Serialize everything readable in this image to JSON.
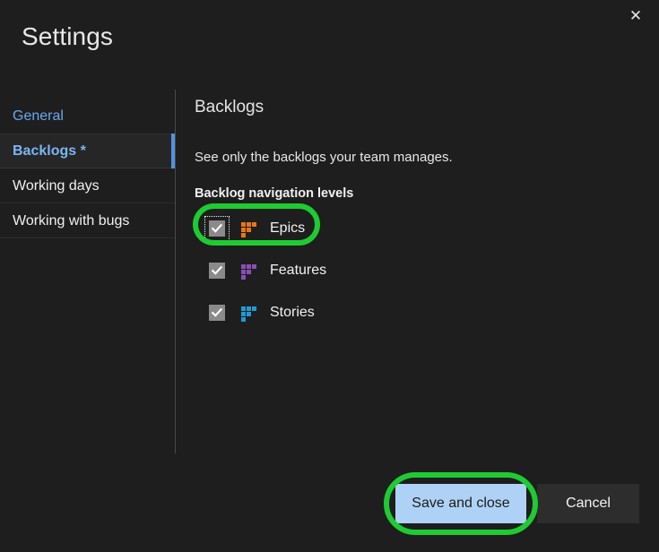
{
  "dialog": {
    "title": "Settings",
    "close_icon": "close-icon",
    "close_glyph": "✕"
  },
  "sidebar": {
    "items": [
      {
        "label": "General",
        "state": "link",
        "selected": false
      },
      {
        "label": "Backlogs *",
        "state": "selected",
        "selected": true
      },
      {
        "label": "Working days",
        "state": "normal",
        "selected": false
      },
      {
        "label": "Working with bugs",
        "state": "normal",
        "selected": false
      }
    ]
  },
  "content": {
    "heading": "Backlogs",
    "description": "See only the backlogs your team manages.",
    "group_label": "Backlog navigation levels",
    "levels": [
      {
        "label": "Epics",
        "checked": true,
        "focused": true,
        "highlighted": true,
        "icon": "backlog-level-icon",
        "color": "#e8761a"
      },
      {
        "label": "Features",
        "checked": true,
        "focused": false,
        "highlighted": false,
        "icon": "backlog-level-icon",
        "color": "#8b4fb8"
      },
      {
        "label": "Stories",
        "checked": true,
        "focused": false,
        "highlighted": false,
        "icon": "backlog-level-icon",
        "color": "#1f9bd4"
      }
    ]
  },
  "footer": {
    "save_label": "Save and close",
    "cancel_label": "Cancel",
    "save_highlighted": true
  },
  "colors": {
    "background": "#1e1e1e",
    "selected_row": "#262626",
    "accent_blue": "#4f93e0",
    "link_blue": "#6aa9f0",
    "primary_button": "#aed2f5",
    "secondary_button": "#2d2d2d",
    "highlight_green": "#1ecb32",
    "epics_icon": "#e8761a",
    "features_icon": "#8b4fb8",
    "stories_icon": "#1f9bd4"
  }
}
